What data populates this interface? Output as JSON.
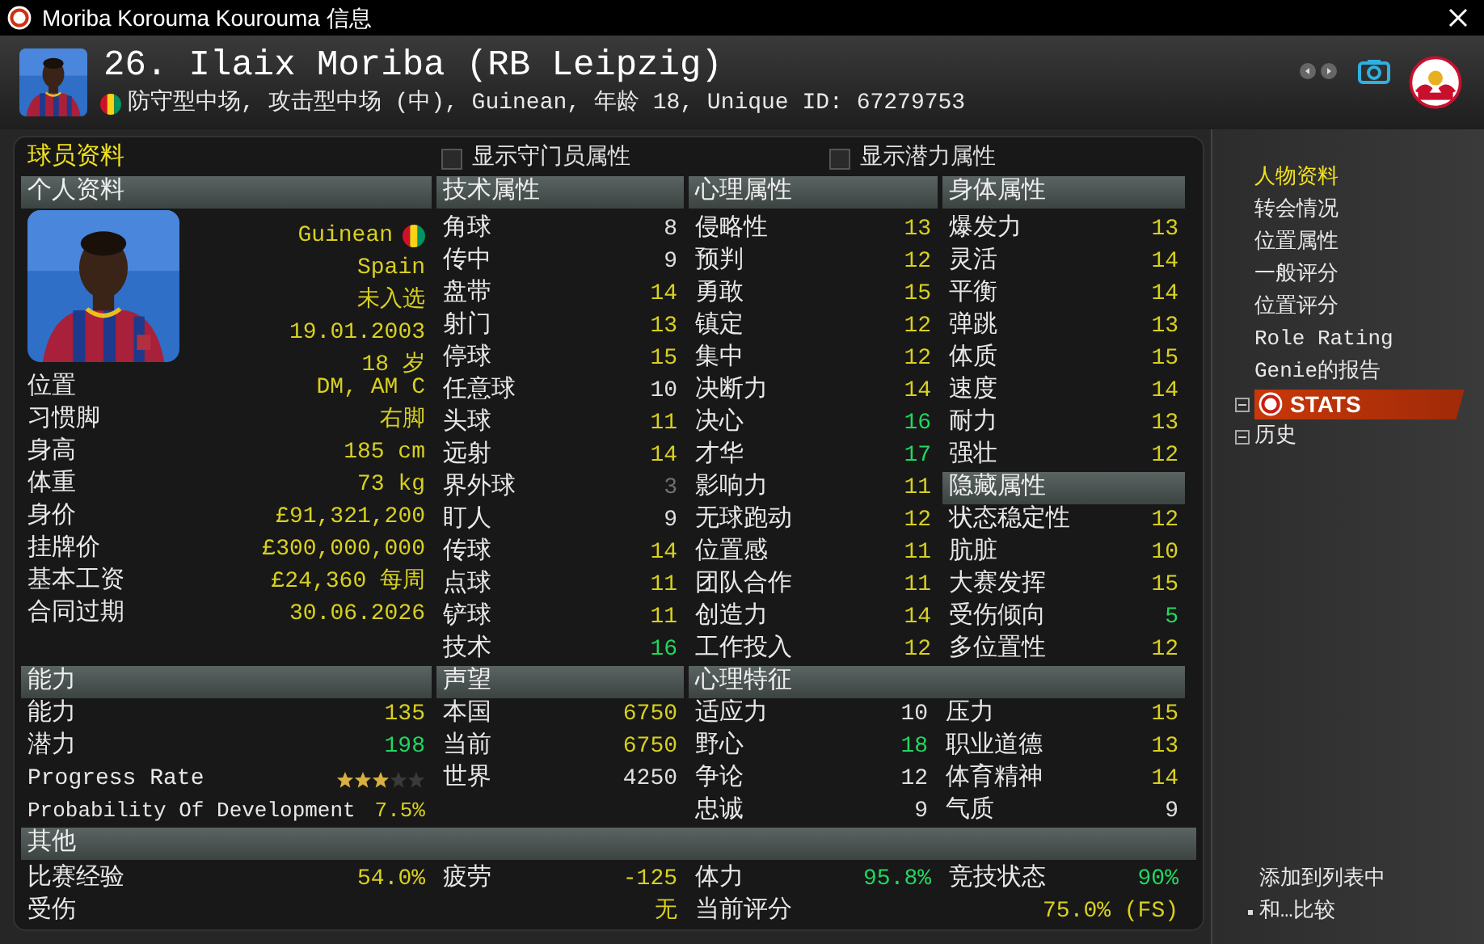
{
  "window": {
    "title": "Moriba Korouma Kourouma 信息"
  },
  "header": {
    "name": "26. Ilaix Moriba (RB Leipzig)",
    "subtitle": "防守型中场, 攻击型中场 (中), Guinean, 年龄 18, Unique ID: 67279753"
  },
  "panel_title": "球员资料",
  "checkboxes": [
    {
      "label": "显示守门员属性",
      "checked": false
    },
    {
      "label": "显示潜力属性",
      "checked": false
    }
  ],
  "personal": {
    "title": "个人资料",
    "photo_values": [
      "Guinean",
      "Spain",
      "未入选",
      "19.01.2003",
      "18 岁"
    ],
    "rows": [
      {
        "label": "位置",
        "value": "DM, AM C"
      },
      {
        "label": "习惯脚",
        "value": "右脚"
      },
      {
        "label": "身高",
        "value": "185 cm"
      },
      {
        "label": "体重",
        "value": "73 kg"
      },
      {
        "label": "身价",
        "value": "£91,321,200"
      },
      {
        "label": "挂牌价",
        "value": "£300,000,000"
      },
      {
        "label": "基本工资",
        "value": "£24,360 每周"
      },
      {
        "label": "合同过期",
        "value": "30.06.2026"
      }
    ]
  },
  "attribute_groups": [
    {
      "title": "技术属性",
      "rows": [
        {
          "label": "角球",
          "value": "8",
          "color": "#e0e0e0"
        },
        {
          "label": "传中",
          "value": "9",
          "color": "#e0e0e0"
        },
        {
          "label": "盘带",
          "value": "14",
          "color": "#d8d020"
        },
        {
          "label": "射门",
          "value": "13",
          "color": "#d8d020"
        },
        {
          "label": "停球",
          "value": "15",
          "color": "#d8d020"
        },
        {
          "label": "任意球",
          "value": "10",
          "color": "#e0e0e0"
        },
        {
          "label": "头球",
          "value": "11",
          "color": "#d8d020"
        },
        {
          "label": "远射",
          "value": "14",
          "color": "#d8d020"
        },
        {
          "label": "界外球",
          "value": "3",
          "color": "#707070"
        },
        {
          "label": "盯人",
          "value": "9",
          "color": "#e0e0e0"
        },
        {
          "label": "传球",
          "value": "14",
          "color": "#d8d020"
        },
        {
          "label": "点球",
          "value": "11",
          "color": "#d8d020"
        },
        {
          "label": "铲球",
          "value": "11",
          "color": "#d8d020"
        },
        {
          "label": "技术",
          "value": "16",
          "color": "#20d860"
        }
      ]
    },
    {
      "title": "心理属性",
      "rows": [
        {
          "label": "侵略性",
          "value": "13",
          "color": "#d8d020"
        },
        {
          "label": "预判",
          "value": "12",
          "color": "#d8d020"
        },
        {
          "label": "勇敢",
          "value": "15",
          "color": "#d8d020"
        },
        {
          "label": "镇定",
          "value": "12",
          "color": "#d8d020"
        },
        {
          "label": "集中",
          "value": "12",
          "color": "#d8d020"
        },
        {
          "label": "决断力",
          "value": "14",
          "color": "#d8d020"
        },
        {
          "label": "决心",
          "value": "16",
          "color": "#20d860"
        },
        {
          "label": "才华",
          "value": "17",
          "color": "#20d860"
        },
        {
          "label": "影响力",
          "value": "11",
          "color": "#d8d020"
        },
        {
          "label": "无球跑动",
          "value": "12",
          "color": "#d8d020"
        },
        {
          "label": "位置感",
          "value": "11",
          "color": "#d8d020"
        },
        {
          "label": "团队合作",
          "value": "11",
          "color": "#d8d020"
        },
        {
          "label": "创造力",
          "value": "14",
          "color": "#d8d020"
        },
        {
          "label": "工作投入",
          "value": "12",
          "color": "#d8d020"
        }
      ]
    },
    {
      "title": "身体属性",
      "rows": [
        {
          "label": "爆发力",
          "value": "13",
          "color": "#d8d020"
        },
        {
          "label": "灵活",
          "value": "14",
          "color": "#d8d020"
        },
        {
          "label": "平衡",
          "value": "14",
          "color": "#d8d020"
        },
        {
          "label": "弹跳",
          "value": "13",
          "color": "#d8d020"
        },
        {
          "label": "体质",
          "value": "15",
          "color": "#d8d020"
        },
        {
          "label": "速度",
          "value": "14",
          "color": "#d8d020"
        },
        {
          "label": "耐力",
          "value": "13",
          "color": "#d8d020"
        },
        {
          "label": "强壮",
          "value": "12",
          "color": "#d8d020"
        }
      ],
      "hidden_title": "隐藏属性",
      "hidden_rows": [
        {
          "label": "状态稳定性",
          "value": "12",
          "color": "#d8d020"
        },
        {
          "label": "肮脏",
          "value": "10",
          "color": "#d8d020"
        },
        {
          "label": "大赛发挥",
          "value": "15",
          "color": "#d8d020"
        },
        {
          "label": "受伤倾向",
          "value": "5",
          "color": "#20d860"
        },
        {
          "label": "多位置性",
          "value": "12",
          "color": "#d8d020"
        }
      ]
    }
  ],
  "ability": {
    "title": "能力",
    "rows": [
      {
        "label": "能力",
        "value": "135",
        "color": "#d8d020"
      },
      {
        "label": "潜力",
        "value": "198",
        "color": "#20d860"
      }
    ],
    "progress_rate": {
      "label": "Progress Rate",
      "stars": 3
    },
    "development": {
      "label": "Probability Of Development",
      "value": "7.5%"
    }
  },
  "reputation": {
    "title": "声望",
    "rows": [
      {
        "label": "本国",
        "value": "6750",
        "color": "#d8d020"
      },
      {
        "label": "当前",
        "value": "6750",
        "color": "#d8d020"
      },
      {
        "label": "世界",
        "value": "4250",
        "color": "#e0e0e0"
      }
    ]
  },
  "traits": {
    "title": "心理特征",
    "rows": [
      {
        "label": "适应力",
        "value": "10",
        "color": "#e0e0e0"
      },
      {
        "label": "压力",
        "value": "15",
        "color": "#d8d020"
      },
      {
        "label": "野心",
        "value": "18",
        "color": "#20d860"
      },
      {
        "label": "职业道德",
        "value": "13",
        "color": "#d8d020"
      },
      {
        "label": "争论",
        "value": "12",
        "color": "#e0e0e0"
      },
      {
        "label": "体育精神",
        "value": "14",
        "color": "#d8d020"
      },
      {
        "label": "忠诚",
        "value": "9",
        "color": "#e0e0e0"
      },
      {
        "label": "气质",
        "value": "9",
        "color": "#e0e0e0"
      }
    ]
  },
  "other": {
    "title": "其他",
    "rows": [
      {
        "kind": "cell",
        "label": "比赛经验",
        "value": "54.0%",
        "color": "#d8d020"
      },
      {
        "kind": "cell",
        "label": "疲劳",
        "value": "-125",
        "color": "#d8d020"
      },
      {
        "kind": "cell",
        "label": "体力",
        "value": "95.8%",
        "color": "#20d860"
      },
      {
        "kind": "cell",
        "label": "竞技状态",
        "value": "90%",
        "color": "#20d860"
      },
      {
        "kind": "wide",
        "label": "受伤",
        "value": "无",
        "color": "#d8d020"
      },
      {
        "kind": "wide",
        "label": "当前评分",
        "value": "75.0% (FS)",
        "color": "#d8d020"
      }
    ]
  },
  "sidebar": {
    "items": [
      {
        "label": "人物资料",
        "selected": true,
        "kind": "link"
      },
      {
        "label": "转会情况",
        "selected": false,
        "kind": "link"
      },
      {
        "label": "位置属性",
        "selected": false,
        "kind": "link"
      },
      {
        "label": "一般评分",
        "selected": false,
        "kind": "link"
      },
      {
        "label": "位置评分",
        "selected": false,
        "kind": "link"
      },
      {
        "label": "Role Rating",
        "selected": false,
        "kind": "link"
      },
      {
        "label": "Genie的报告",
        "selected": false,
        "kind": "link"
      },
      {
        "label": "STATS",
        "selected": false,
        "kind": "banner"
      },
      {
        "label": "历史",
        "selected": false,
        "kind": "group"
      }
    ],
    "actions": [
      {
        "label": "添加到列表中",
        "kind": "plain"
      },
      {
        "label": "和…比较",
        "kind": "bullet"
      }
    ]
  }
}
